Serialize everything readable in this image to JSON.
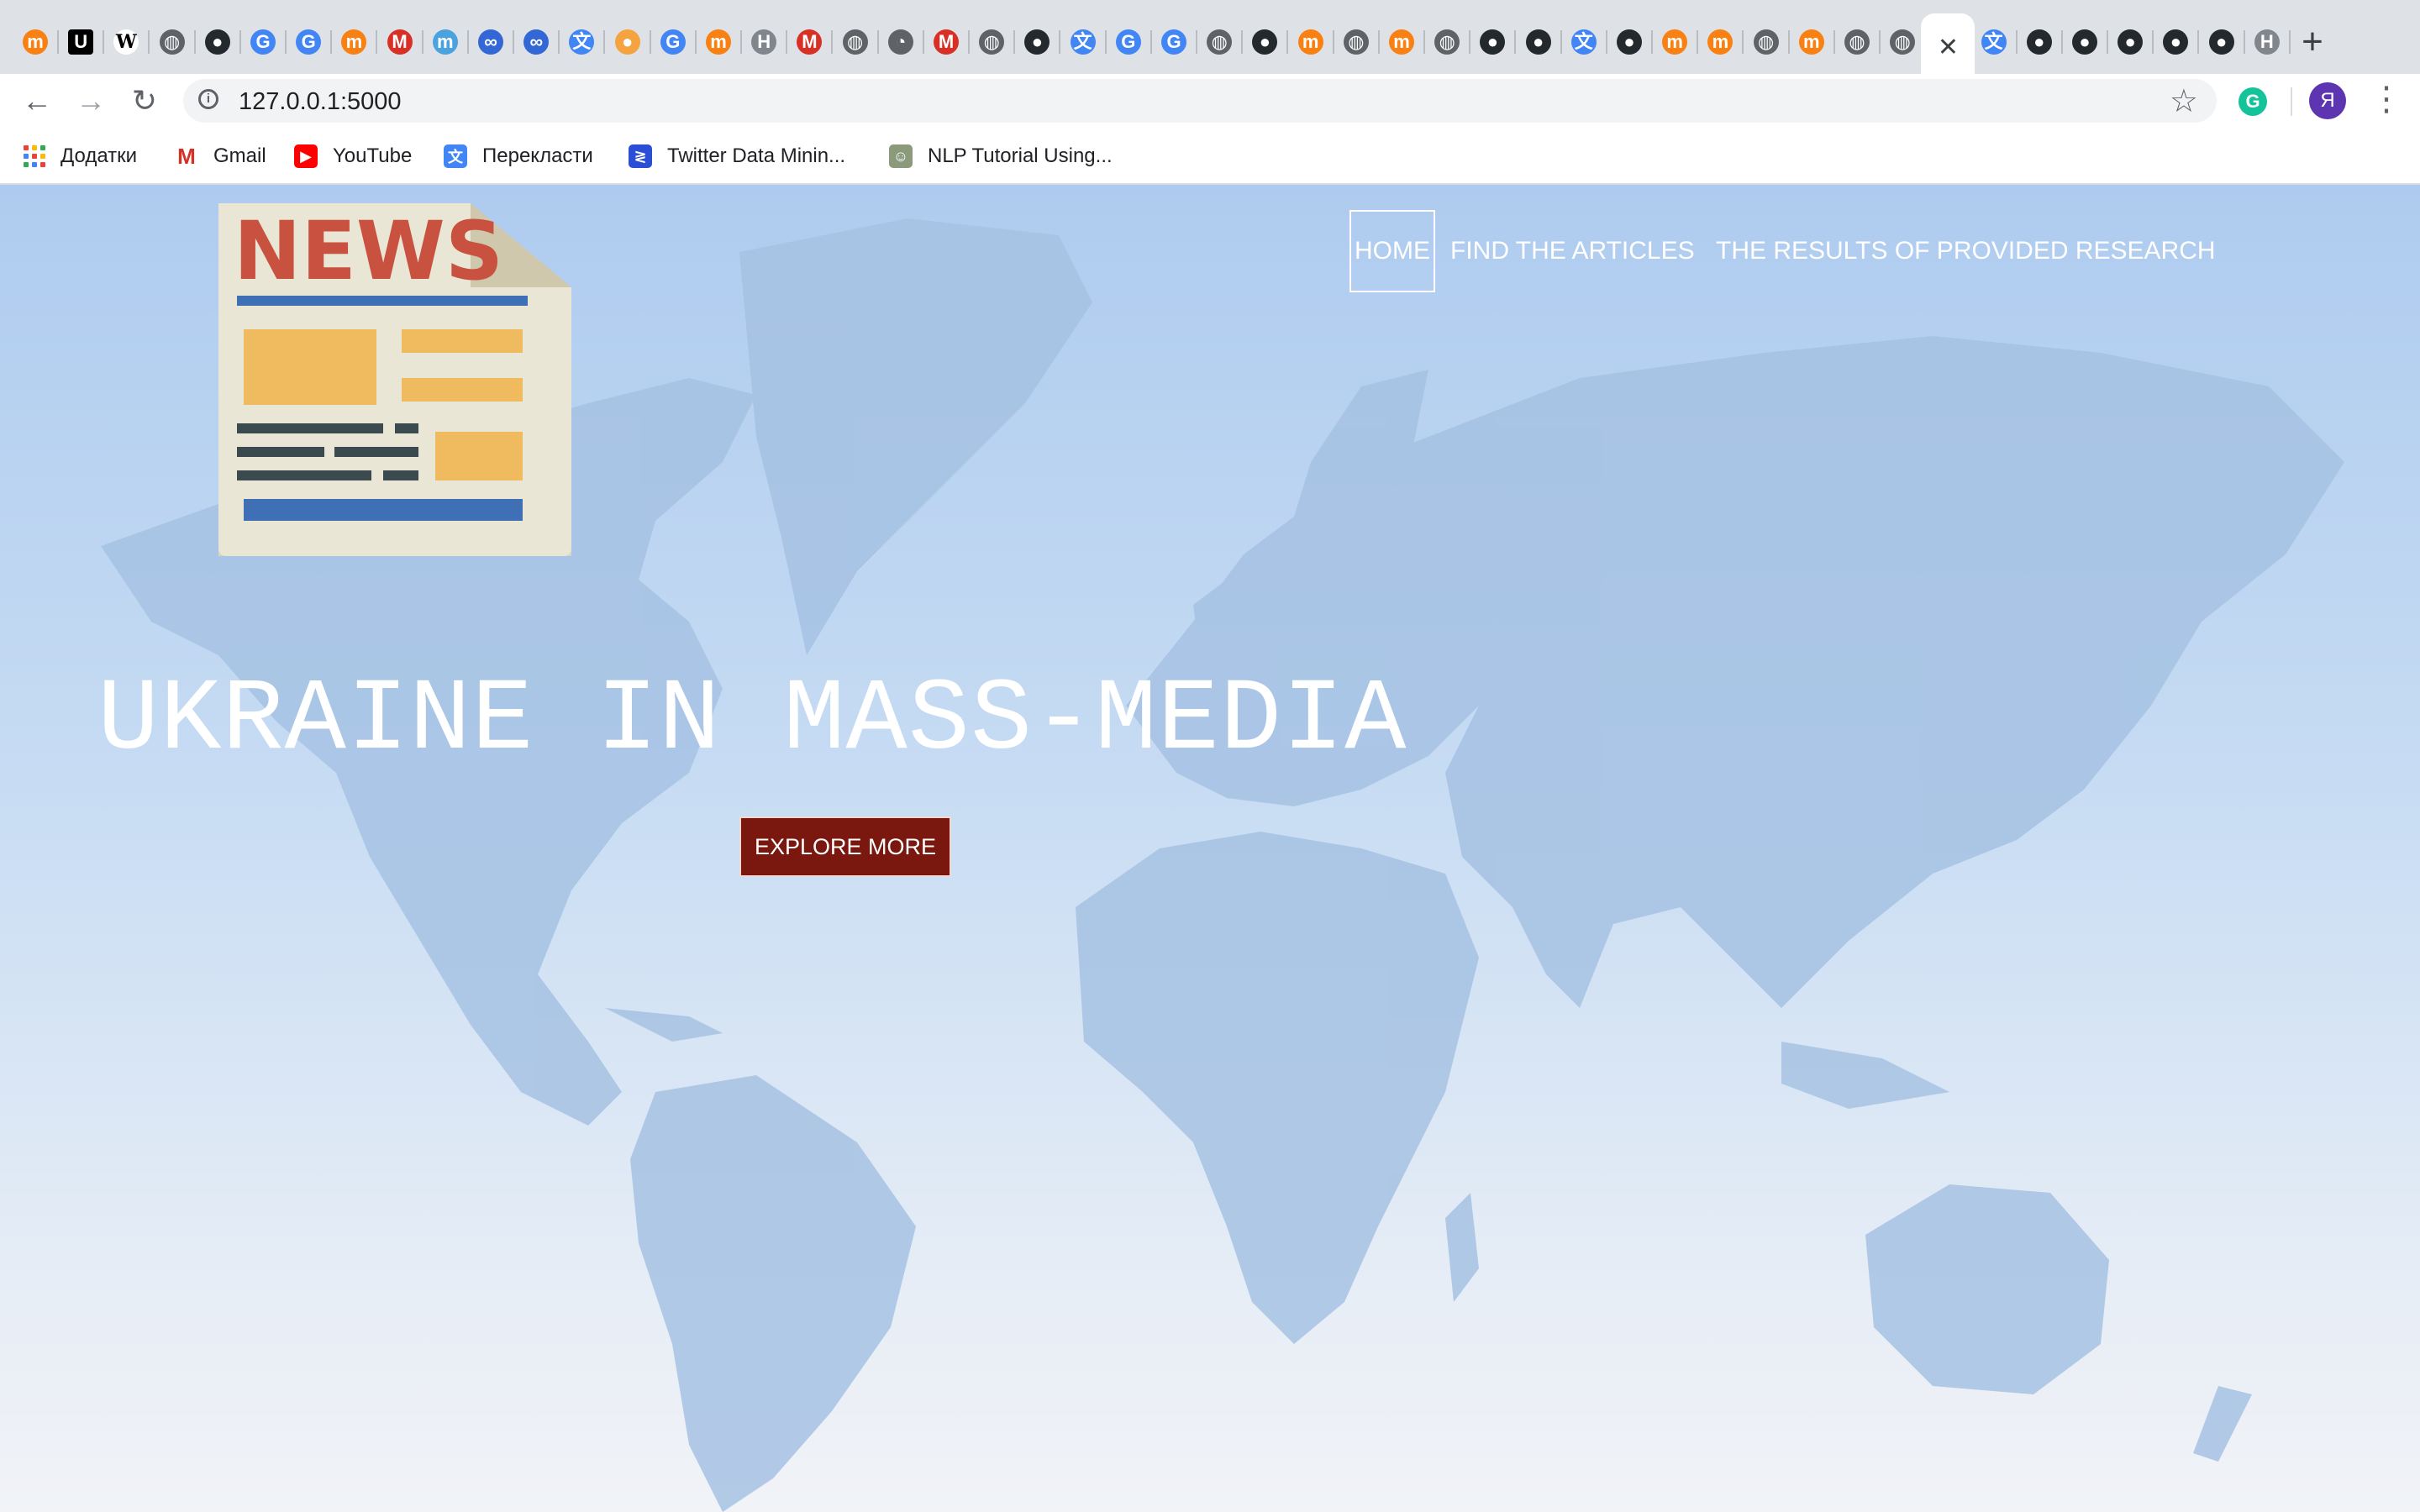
{
  "browser": {
    "tabs": [
      {
        "icon": "moodle-icon",
        "glyph": "m",
        "bg": "#f98012"
      },
      {
        "icon": "u-icon",
        "glyph": "U",
        "bg": "#000000"
      },
      {
        "icon": "wikipedia-icon",
        "glyph": "W",
        "bg": "#ffffff"
      },
      {
        "icon": "globe-icon",
        "glyph": "◍",
        "bg": "#5f6368"
      },
      {
        "icon": "github-icon",
        "glyph": "●",
        "bg": "#24292e"
      },
      {
        "icon": "google-icon",
        "glyph": "G",
        "bg": "#4285f4"
      },
      {
        "icon": "google-icon",
        "glyph": "G",
        "bg": "#4285f4"
      },
      {
        "icon": "moodle-icon",
        "glyph": "m",
        "bg": "#f98012"
      },
      {
        "icon": "gmail-icon",
        "glyph": "M",
        "bg": "#d93025"
      },
      {
        "icon": "m-circle-icon",
        "glyph": "m",
        "bg": "#4aa3df"
      },
      {
        "icon": "infinity-icon",
        "glyph": "∞",
        "bg": "#3367d6"
      },
      {
        "icon": "infinity-icon",
        "glyph": "∞",
        "bg": "#3367d6"
      },
      {
        "icon": "translate-icon",
        "glyph": "文",
        "bg": "#4285f4"
      },
      {
        "icon": "drop-icon",
        "glyph": "●",
        "bg": "#f4a340"
      },
      {
        "icon": "google-icon",
        "glyph": "G",
        "bg": "#4285f4"
      },
      {
        "icon": "moodle-icon",
        "glyph": "m",
        "bg": "#f98012"
      },
      {
        "icon": "h-icon",
        "glyph": "H",
        "bg": "#80868b"
      },
      {
        "icon": "gmail-icon",
        "glyph": "M",
        "bg": "#d93025"
      },
      {
        "icon": "globe-icon",
        "glyph": "◍",
        "bg": "#5f6368"
      },
      {
        "icon": "speed-icon",
        "glyph": "◔",
        "bg": "#5f6368"
      },
      {
        "icon": "gmail-icon",
        "glyph": "M",
        "bg": "#d93025"
      },
      {
        "icon": "globe-icon",
        "glyph": "◍",
        "bg": "#5f6368"
      },
      {
        "icon": "github-icon",
        "glyph": "●",
        "bg": "#24292e"
      },
      {
        "icon": "translate-icon",
        "glyph": "文",
        "bg": "#4285f4"
      },
      {
        "icon": "google-icon",
        "glyph": "G",
        "bg": "#4285f4"
      },
      {
        "icon": "google-icon",
        "glyph": "G",
        "bg": "#4285f4"
      },
      {
        "icon": "globe-icon",
        "glyph": "◍",
        "bg": "#5f6368"
      },
      {
        "icon": "github-icon",
        "glyph": "●",
        "bg": "#24292e"
      },
      {
        "icon": "moodle-icon",
        "glyph": "m",
        "bg": "#f98012"
      },
      {
        "icon": "globe-icon",
        "glyph": "◍",
        "bg": "#5f6368"
      },
      {
        "icon": "moodle-icon",
        "glyph": "m",
        "bg": "#f98012"
      },
      {
        "icon": "globe-icon",
        "glyph": "◍",
        "bg": "#5f6368"
      },
      {
        "icon": "github-icon",
        "glyph": "●",
        "bg": "#24292e"
      },
      {
        "icon": "github-icon",
        "glyph": "●",
        "bg": "#24292e"
      },
      {
        "icon": "translate-icon",
        "glyph": "文",
        "bg": "#4285f4"
      },
      {
        "icon": "github-icon",
        "glyph": "●",
        "bg": "#24292e"
      },
      {
        "icon": "moodle-icon",
        "glyph": "m",
        "bg": "#f98012"
      },
      {
        "icon": "moodle-icon",
        "glyph": "m",
        "bg": "#f98012"
      },
      {
        "icon": "globe-icon",
        "glyph": "◍",
        "bg": "#5f6368"
      },
      {
        "icon": "moodle-icon",
        "glyph": "m",
        "bg": "#f98012"
      },
      {
        "icon": "globe-icon",
        "glyph": "◍",
        "bg": "#5f6368"
      },
      {
        "icon": "globe-icon",
        "glyph": "◍",
        "bg": "#5f6368"
      },
      {
        "icon": "close-icon",
        "glyph": "✕",
        "bg": "#ffffff",
        "active": true
      },
      {
        "icon": "translate-icon",
        "glyph": "文",
        "bg": "#4285f4"
      },
      {
        "icon": "github-icon",
        "glyph": "●",
        "bg": "#24292e"
      },
      {
        "icon": "github-icon",
        "glyph": "●",
        "bg": "#24292e"
      },
      {
        "icon": "github-icon",
        "glyph": "●",
        "bg": "#24292e"
      },
      {
        "icon": "github-icon",
        "glyph": "●",
        "bg": "#24292e"
      },
      {
        "icon": "github-icon",
        "glyph": "●",
        "bg": "#24292e"
      },
      {
        "icon": "h-icon",
        "glyph": "H",
        "bg": "#80868b"
      }
    ],
    "new_tab": "+",
    "url": "127.0.0.1:5000",
    "profile_initial": "Я",
    "extension_initial": "G"
  },
  "bookmarks": [
    {
      "label": "Додатки",
      "icon": "apps-grid-icon"
    },
    {
      "label": "Gmail",
      "icon": "gmail-icon",
      "glyph": "M",
      "color": "#d93025"
    },
    {
      "label": "YouTube",
      "icon": "youtube-icon",
      "glyph": "▶",
      "color": "#ff0000"
    },
    {
      "label": "Перекласти",
      "icon": "translate-icon",
      "glyph": "文",
      "color": "#4285f4"
    },
    {
      "label": "Twitter Data Minin...",
      "icon": "bookmark-icon",
      "glyph": "≷",
      "color": "#2a4fd6"
    },
    {
      "label": "NLP Tutorial Using...",
      "icon": "nlp-icon",
      "glyph": "☺",
      "color": "#8a9a7b"
    }
  ],
  "site": {
    "nav": {
      "home": "HOME",
      "articles": "FIND THE ARTICLES",
      "results": "THE RESULTS OF PROVIDED RESEARCH"
    },
    "logo_text": "NEWS",
    "hero_title": "UKRAINE IN MASS-MEDIA",
    "cta": "EXPLORE MORE",
    "colors": {
      "cta_bg": "#7a1810",
      "logo_red": "#c9513f",
      "logo_yellow": "#f0bb5e",
      "logo_blue": "#3f6fb5"
    }
  }
}
